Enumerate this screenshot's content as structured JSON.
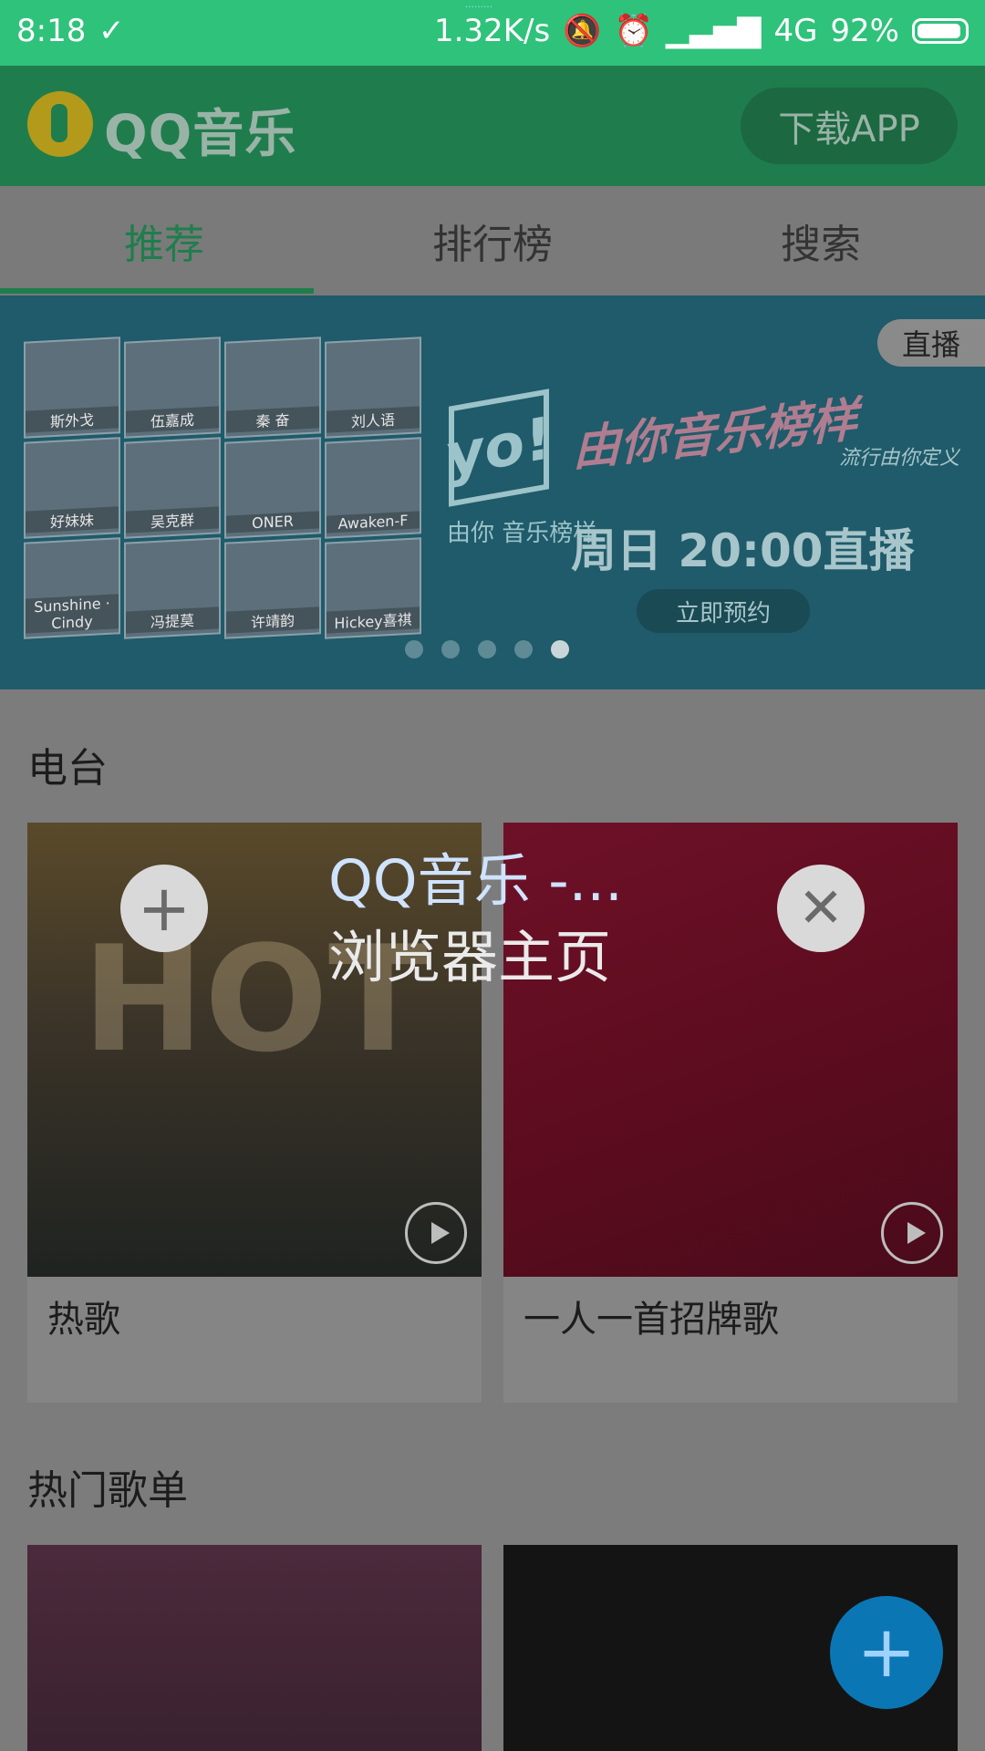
{
  "status_bar": {
    "time": "8:18",
    "network_speed": "1.32K/s",
    "network": "4G",
    "battery": "92%",
    "tiny_text": "………"
  },
  "header": {
    "app_name": "QQ音乐",
    "download_label": "下载APP"
  },
  "tabs": [
    {
      "label": "推荐"
    },
    {
      "label": "排行榜"
    },
    {
      "label": "搜索"
    }
  ],
  "banner": {
    "badge": "直播",
    "brand": "yo!",
    "brand_sub": "由你 音乐榜样",
    "title": "由你音乐榜样",
    "slogan": "流行由你定义",
    "time": "周日 20:00直播",
    "cta": "立即预约",
    "artists": [
      "斯外戈",
      "伍嘉成",
      "秦 奋",
      "刘人语",
      "好妹妹",
      "吴克群",
      "ONER",
      "Awaken-F",
      "Sunshine · Cindy",
      "冯提莫",
      "许靖韵",
      "Hickey喜祺"
    ],
    "carousel_index": 5,
    "carousel_count": 5
  },
  "radio": {
    "title": "电台",
    "items": [
      {
        "label": "热歌"
      },
      {
        "label": "一人一首招牌歌"
      }
    ]
  },
  "playlists": {
    "title": "热门歌单"
  },
  "overlay": {
    "window_title_line1": "QQ音乐 -...",
    "window_title_line2": "浏览器主页"
  },
  "icons": {
    "add": "plus-icon",
    "close": "close-icon",
    "fab": "plus-icon"
  }
}
